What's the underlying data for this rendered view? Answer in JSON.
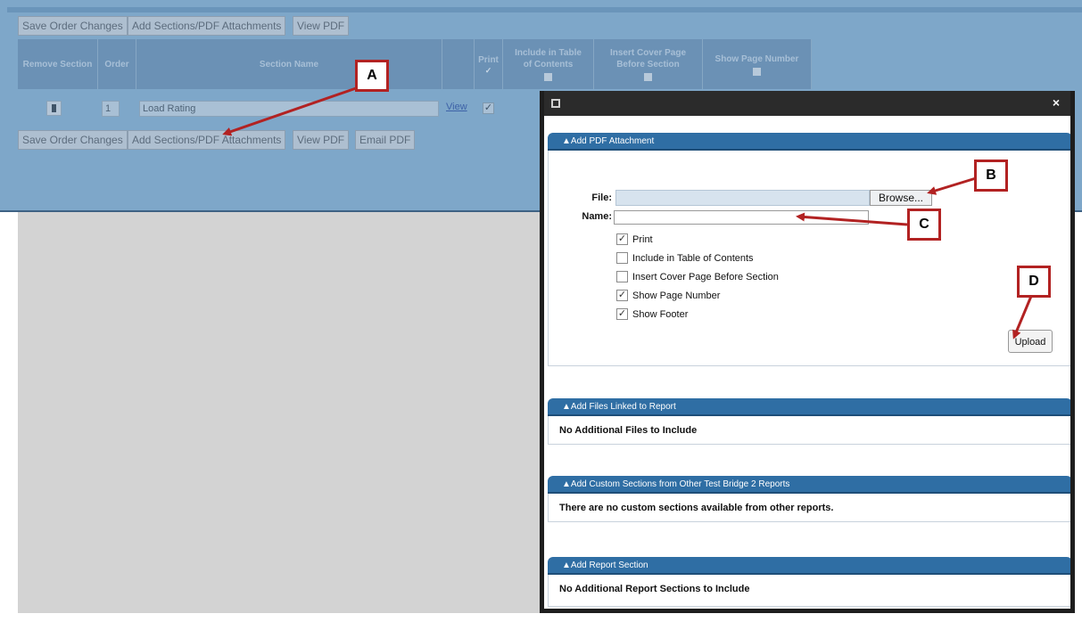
{
  "top_toolbar": {
    "save_label": "Save Order Changes",
    "add_label": "Add Sections/PDF Attachments",
    "view_label": "View PDF"
  },
  "grid": {
    "headers": {
      "remove": "Remove Section",
      "order": "Order",
      "section_name": "Section Name",
      "print": "Print",
      "toc": [
        "Include in Table",
        "of Contents"
      ],
      "cover": [
        "Insert Cover Page",
        "Before Section"
      ],
      "page_number": "Show Page Number"
    },
    "row": {
      "order": "1",
      "section_name": "Load Rating",
      "view_link": "View",
      "print_checked": true
    }
  },
  "bottom_toolbar": {
    "save_label": "Save Order Changes",
    "add_label": "Add Sections/PDF Attachments",
    "view_label": "View PDF",
    "email_label": "Email PDF"
  },
  "modal": {
    "close_glyph": "×",
    "pdf_section": {
      "header": "▲Add PDF Attachment",
      "file_label": "File:",
      "browse_label": "Browse...",
      "name_label": "Name:",
      "options": [
        {
          "label": "Print",
          "checked": true
        },
        {
          "label": "Include in Table of Contents",
          "checked": false
        },
        {
          "label": "Insert Cover Page Before Section",
          "checked": false
        },
        {
          "label": "Show Page Number",
          "checked": true
        },
        {
          "label": "Show Footer",
          "checked": true
        }
      ],
      "upload_label": "Upload"
    },
    "files_section": {
      "header": "▲Add Files Linked to Report",
      "body": "No Additional Files to Include"
    },
    "custom_section": {
      "header": "▲Add Custom Sections from Other Test Bridge 2 Reports",
      "body": "There are no custom sections available from other reports."
    },
    "report_section": {
      "header": "▲Add Report Section",
      "body": "No Additional Report Sections to Include"
    }
  },
  "callouts": {
    "a": "A",
    "b": "B",
    "c": "C",
    "d": "D"
  },
  "check_glyph": "✓",
  "colors": {
    "callout_red": "#b22222",
    "section_header_blue": "#2f6ea4",
    "overlay_blue": "#7ea7c9"
  }
}
